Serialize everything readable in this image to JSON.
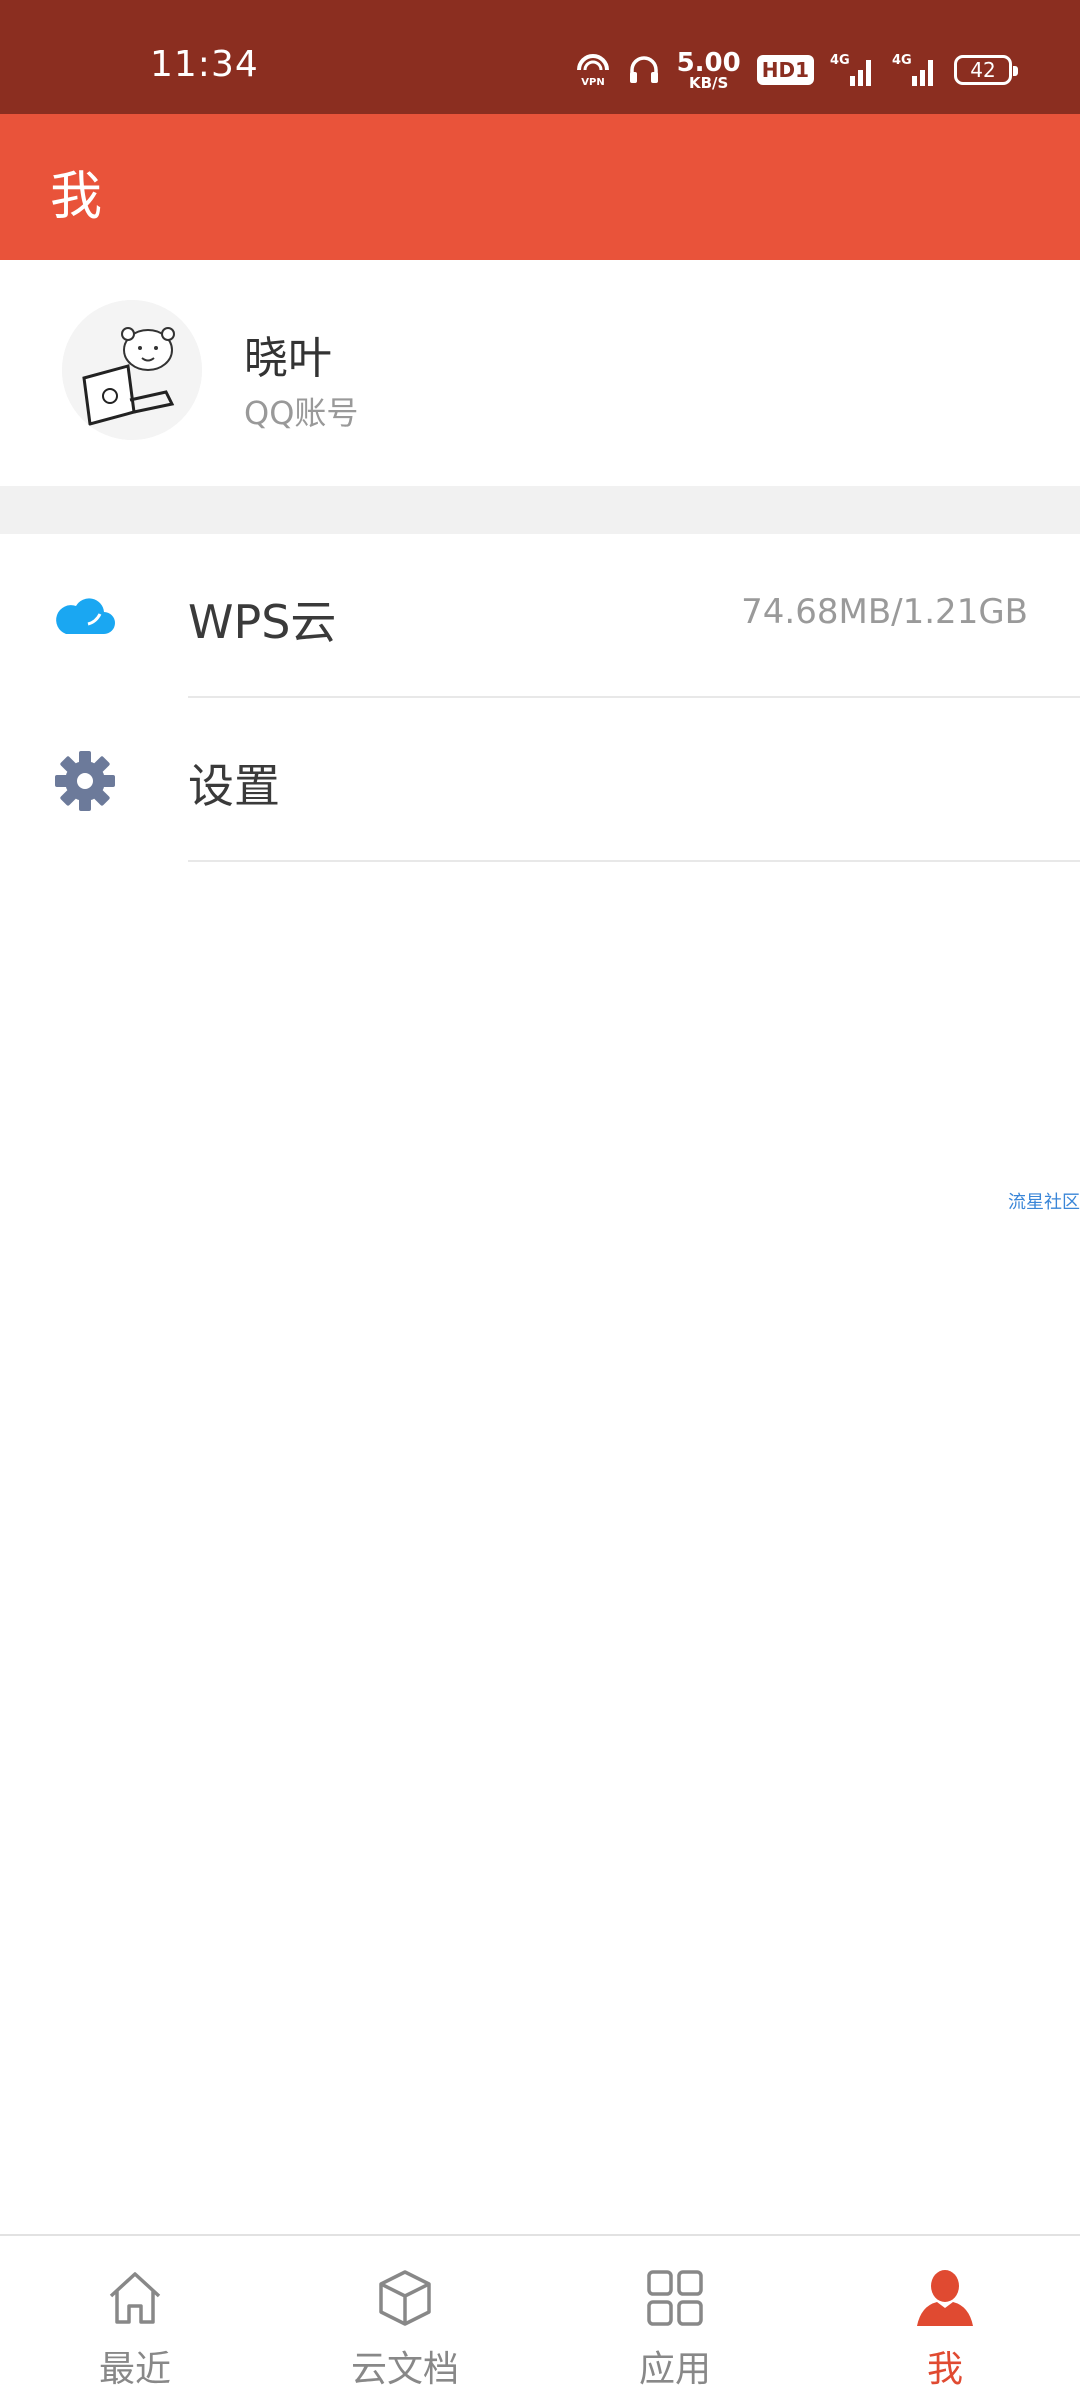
{
  "status_bar": {
    "time": "11:34",
    "vpn_label": "VPN",
    "speed_value": "5.00",
    "speed_unit": "KB/S",
    "hd_label": "HD1",
    "signal1_label": "4G",
    "signal2_label": "4G",
    "battery": "42"
  },
  "app_bar": {
    "title": "我",
    "color": "#e9533a"
  },
  "profile": {
    "name": "晓叶",
    "account_type": "QQ账号"
  },
  "menu": [
    {
      "label": "WPS云",
      "value": "74.68MB/1.21GB",
      "icon": "cloud-icon",
      "icon_color": "#1aa7f2"
    },
    {
      "label": "设置",
      "icon": "gear-icon",
      "icon_color": "#6c7a9a"
    }
  ],
  "watermark": "流星社区",
  "tabs": [
    {
      "label": "最近",
      "icon": "home-icon",
      "active": false
    },
    {
      "label": "云文档",
      "icon": "cube-icon",
      "active": false
    },
    {
      "label": "应用",
      "icon": "grid-icon",
      "active": false
    },
    {
      "label": "我",
      "icon": "person-icon",
      "active": true,
      "active_color": "#e04a31"
    }
  ]
}
